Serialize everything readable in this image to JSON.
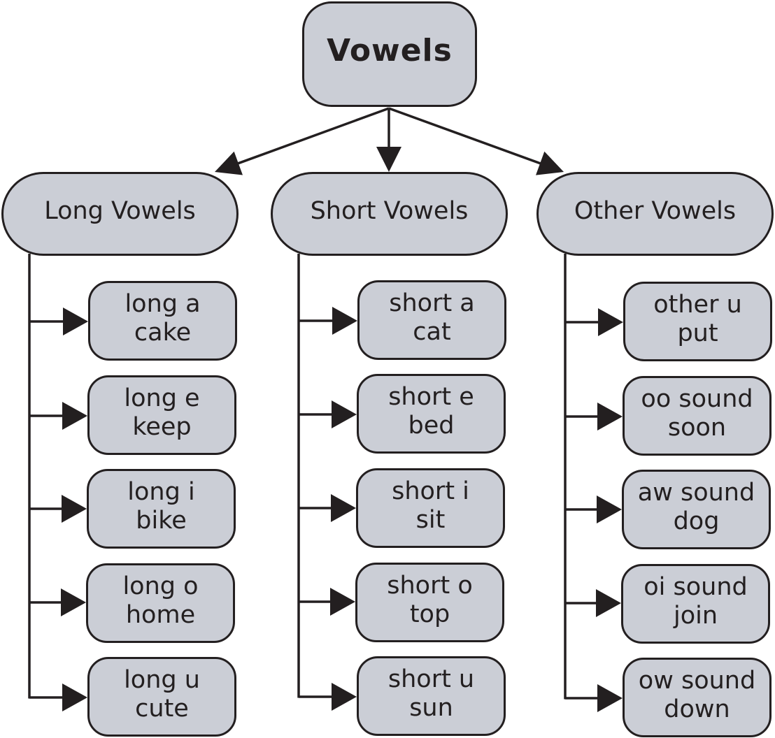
{
  "diagram": {
    "root": {
      "label": "Vowels"
    },
    "categories": [
      {
        "label": "Long Vowels",
        "items": [
          {
            "sound": "long a",
            "example": "cake"
          },
          {
            "sound": "long e",
            "example": "keep"
          },
          {
            "sound": "long i",
            "example": "bike"
          },
          {
            "sound": "long o",
            "example": "home"
          },
          {
            "sound": "long u",
            "example": "cute"
          }
        ]
      },
      {
        "label": "Short Vowels",
        "items": [
          {
            "sound": "short a",
            "example": "cat"
          },
          {
            "sound": "short e",
            "example": "bed"
          },
          {
            "sound": "short i",
            "example": "sit"
          },
          {
            "sound": "short o",
            "example": "top"
          },
          {
            "sound": "short u",
            "example": "sun"
          }
        ]
      },
      {
        "label": "Other Vowels",
        "items": [
          {
            "sound": "other u",
            "example": "put"
          },
          {
            "sound": "oo sound",
            "example": "soon"
          },
          {
            "sound": "aw sound",
            "example": "dog"
          },
          {
            "sound": "oi sound",
            "example": "join"
          },
          {
            "sound": "ow sound",
            "example": "down"
          }
        ]
      }
    ],
    "colors": {
      "box_fill": "#cbced6",
      "stroke": "#231f20",
      "background": "#ffffff"
    }
  }
}
